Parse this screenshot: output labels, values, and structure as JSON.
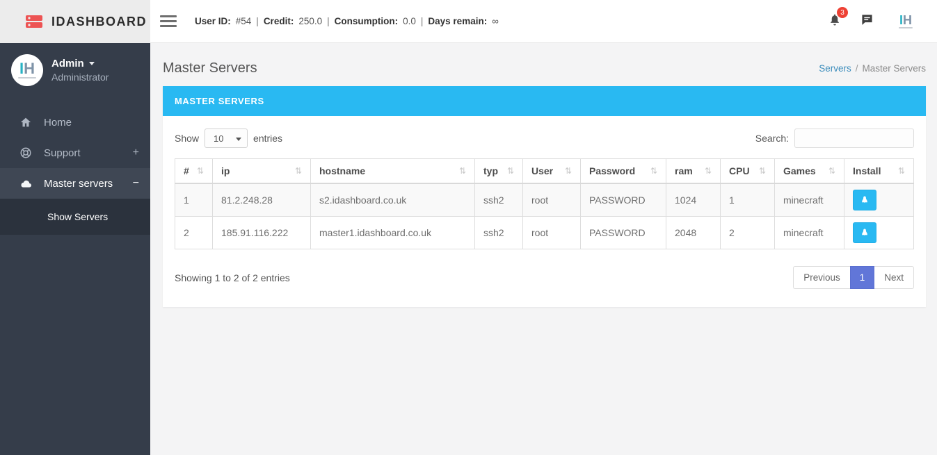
{
  "brand": {
    "name": "IDASHBOARD",
    "logo_color": "#ed5353"
  },
  "topbar": {
    "separator": "|",
    "stats": [
      {
        "label": "User ID:",
        "value": "#54"
      },
      {
        "label": "Credit:",
        "value": "250.0"
      },
      {
        "label": "Consumption:",
        "value": "0.0"
      },
      {
        "label": "Days remain:",
        "value": "∞"
      }
    ],
    "notification_count": "3"
  },
  "sidebar": {
    "user": {
      "name": "Admin",
      "role": "Administrator",
      "avatar_i": "I",
      "avatar_h": "H"
    },
    "items": [
      {
        "label": "Home",
        "icon": "home-icon",
        "suffix": ""
      },
      {
        "label": "Support",
        "icon": "life-ring-icon",
        "suffix": "+"
      },
      {
        "label": "Master servers",
        "icon": "cloud-icon",
        "suffix": "−",
        "active": true
      }
    ],
    "subitems": [
      {
        "label": "Show Servers"
      }
    ]
  },
  "page": {
    "title": "Master Servers",
    "breadcrumb": {
      "link": "Servers",
      "separator": "/",
      "current": "Master Servers"
    }
  },
  "panel": {
    "header": "MASTER SERVERS",
    "show_label": "Show",
    "entries_value": "10",
    "entries_label": "entries",
    "search_label": "Search:",
    "table": {
      "columns": [
        "#",
        "ip",
        "hostname",
        "typ",
        "User",
        "Password",
        "ram",
        "CPU",
        "Games",
        "Install"
      ],
      "rows": [
        {
          "num": "1",
          "ip": "81.2.248.28",
          "hostname": "s2.idashboard.co.uk",
          "typ": "ssh2",
          "user": "root",
          "password": "PASSWORD",
          "ram": "1024",
          "cpu": "1",
          "games": "minecraft"
        },
        {
          "num": "2",
          "ip": "185.91.116.222",
          "hostname": "master1.idashboard.co.uk",
          "typ": "ssh2",
          "user": "root",
          "password": "PASSWORD",
          "ram": "2048",
          "cpu": "2",
          "games": "minecraft"
        }
      ]
    },
    "footer": {
      "info": "Showing 1 to 2 of 2 entries",
      "pagination": {
        "previous": "Previous",
        "page": "1",
        "next": "Next"
      }
    }
  },
  "icons": {
    "sort": "⇅"
  },
  "colors": {
    "accent_cyan": "#29b9f2",
    "sidebar_bg": "#353d4a",
    "sidebar_active_bg": "#3f4754",
    "submenu_bg": "#2b323d",
    "pagination_active": "#6176d8",
    "breadcrumb_link": "#3c8dbc",
    "notification_red": "#ee4134",
    "brand_red": "#ed5353"
  }
}
